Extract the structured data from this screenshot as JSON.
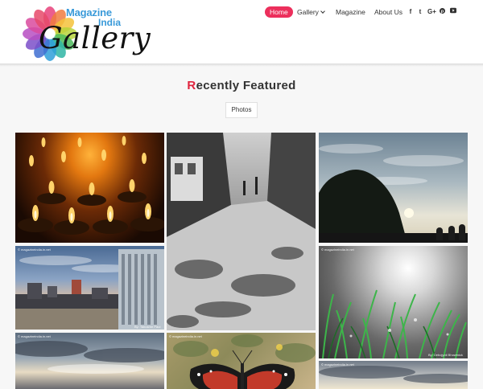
{
  "site": {
    "logo_line1": "Magazine",
    "logo_line2": "India",
    "logo_line3": "Gallery"
  },
  "nav": {
    "items": [
      {
        "label": "Home",
        "active": true
      },
      {
        "label": "Gallery",
        "dropdown": true
      },
      {
        "label": "Magazine"
      },
      {
        "label": "About Us"
      }
    ]
  },
  "social": {
    "icons": [
      "facebook-icon",
      "twitter-icon",
      "google-plus-icon",
      "pinterest-icon",
      "youtube-icon"
    ],
    "glyphs": [
      "f",
      "t",
      "G+",
      "p",
      "▶"
    ]
  },
  "main": {
    "title_first_letter": "R",
    "title_rest": "ecently Featured",
    "filter_label": "Photos"
  },
  "gallery": {
    "watermark": "© magazineindia.in.net",
    "credits": [
      "By: Tanusree Paul",
      "By: Debojyoti Bhowmick"
    ]
  },
  "colors": {
    "accent": "#ec2f5c",
    "title_letter": "#e0243e",
    "logo_blue": "#3a9ad9"
  }
}
